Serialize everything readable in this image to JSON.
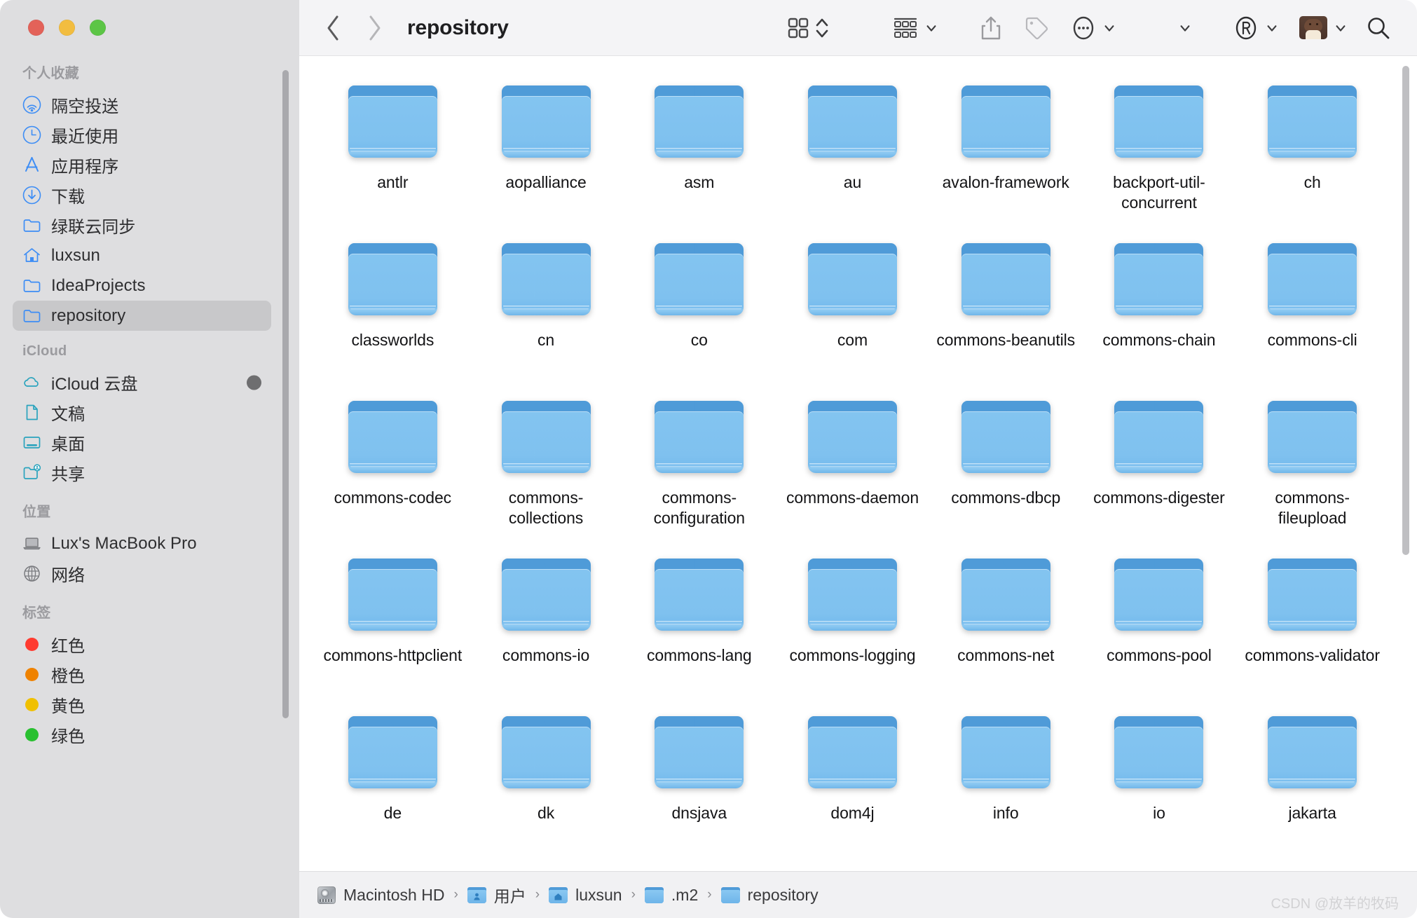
{
  "window": {
    "traffic_lights": [
      {
        "name": "close",
        "color": "#e36259"
      },
      {
        "name": "minimize",
        "color": "#f2bd40"
      },
      {
        "name": "maximize",
        "color": "#5cc546"
      }
    ]
  },
  "sidebar": {
    "groups": [
      {
        "title": "个人收藏",
        "items": [
          {
            "label": "隔空投送",
            "icon": "airdrop-icon",
            "selected": false
          },
          {
            "label": "最近使用",
            "icon": "clock-icon",
            "selected": false
          },
          {
            "label": "应用程序",
            "icon": "applications-icon",
            "selected": false
          },
          {
            "label": "下载",
            "icon": "downloads-icon",
            "selected": false
          },
          {
            "label": "绿联云同步",
            "icon": "folder-icon",
            "selected": false
          },
          {
            "label": "luxsun",
            "icon": "home-icon",
            "selected": false
          },
          {
            "label": "IdeaProjects",
            "icon": "folder-icon",
            "selected": false
          },
          {
            "label": "repository",
            "icon": "folder-icon",
            "selected": true
          }
        ]
      },
      {
        "title": "iCloud",
        "items": [
          {
            "label": "iCloud 云盘",
            "icon": "cloud-icon",
            "selected": false,
            "eject": true
          },
          {
            "label": "文稿",
            "icon": "document-icon",
            "selected": false
          },
          {
            "label": "桌面",
            "icon": "desktop-icon",
            "selected": false
          },
          {
            "label": "共享",
            "icon": "shared-folder-icon",
            "selected": false
          }
        ]
      },
      {
        "title": "位置",
        "items": [
          {
            "label": "Lux's MacBook Pro",
            "icon": "laptop-icon",
            "selected": false
          },
          {
            "label": "网络",
            "icon": "network-icon",
            "selected": false
          }
        ]
      },
      {
        "title": "标签",
        "items": [
          {
            "label": "红色",
            "icon": "tag-dot-icon",
            "color": "#ff3b30",
            "selected": false
          },
          {
            "label": "橙色",
            "icon": "tag-dot-icon",
            "color": "#ef8200",
            "selected": false
          },
          {
            "label": "黄色",
            "icon": "tag-dot-icon",
            "color": "#f0c000",
            "selected": false
          },
          {
            "label": "绿色",
            "icon": "tag-dot-icon",
            "color": "#29c030",
            "selected": false
          }
        ]
      }
    ]
  },
  "toolbar": {
    "back_label": "‹",
    "forward_label": "›",
    "title": "repository",
    "buttons": [
      {
        "name": "icon-view-button",
        "icon": "grid-view-icon"
      },
      {
        "name": "view-options-button",
        "icon": "chevron-updown-icon"
      },
      {
        "name": "group-by-button",
        "icon": "group-view-icon"
      },
      {
        "name": "group-by-menu",
        "icon": "chevron-down-icon"
      },
      {
        "name": "share-button",
        "icon": "share-icon"
      },
      {
        "name": "tag-button",
        "icon": "tag-icon"
      },
      {
        "name": "more-actions-button",
        "icon": "ellipsis-circle-icon"
      },
      {
        "name": "more-actions-menu",
        "icon": "chevron-down-icon"
      },
      {
        "name": "overflow-menu",
        "icon": "chevron-down-icon"
      },
      {
        "name": "registered-button",
        "icon": "registered-mark-icon"
      },
      {
        "name": "registered-menu",
        "icon": "chevron-down-icon"
      },
      {
        "name": "account-avatar",
        "icon": "avatar-icon"
      },
      {
        "name": "account-menu",
        "icon": "chevron-down-icon"
      },
      {
        "name": "search-button",
        "icon": "search-icon"
      }
    ]
  },
  "content": {
    "view": "icon",
    "items": [
      "antlr",
      "aopalliance",
      "asm",
      "au",
      "avalon-framework",
      "backport-util-concurrent",
      "ch",
      "classworlds",
      "cn",
      "co",
      "com",
      "commons-beanutils",
      "commons-chain",
      "commons-cli",
      "commons-codec",
      "commons-collections",
      "commons-configuration",
      "commons-daemon",
      "commons-dbcp",
      "commons-digester",
      "commons-fileupload",
      "commons-httpclient",
      "commons-io",
      "commons-lang",
      "commons-logging",
      "commons-net",
      "commons-pool",
      "commons-validator",
      "de",
      "dk",
      "dnsjava",
      "dom4j",
      "info",
      "io",
      "jakarta"
    ]
  },
  "pathbar": {
    "crumbs": [
      {
        "label": "Macintosh HD",
        "icon": "harddisk-icon"
      },
      {
        "label": "用户",
        "icon": "users-folder-icon"
      },
      {
        "label": "luxsun",
        "icon": "home-folder-icon"
      },
      {
        "label": ".m2",
        "icon": "folder-icon"
      },
      {
        "label": "repository",
        "icon": "folder-icon"
      }
    ],
    "separator": "›"
  },
  "watermark": "CSDN @放羊的牧码"
}
